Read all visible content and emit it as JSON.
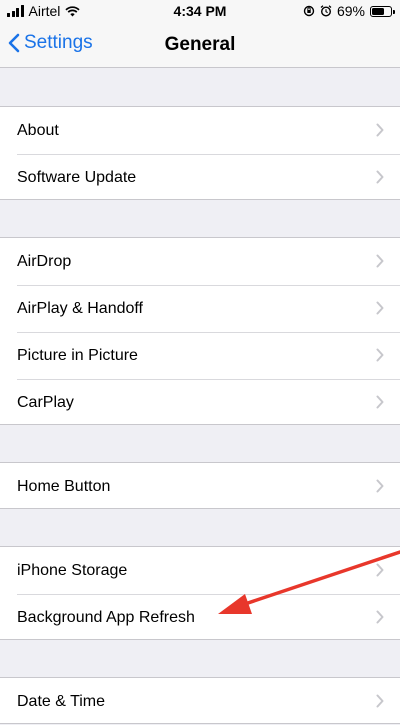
{
  "status_bar": {
    "carrier": "Airtel",
    "time": "4:34 PM",
    "battery_percent": "69%",
    "battery_level": 0.69,
    "icons": [
      "signal-icon",
      "wifi-icon",
      "screen-lock-icon",
      "alarm-icon",
      "battery-icon"
    ]
  },
  "nav": {
    "back_label": "Settings",
    "title": "General"
  },
  "groups": [
    {
      "items": [
        {
          "label": "About"
        },
        {
          "label": "Software Update"
        }
      ]
    },
    {
      "items": [
        {
          "label": "AirDrop"
        },
        {
          "label": "AirPlay & Handoff"
        },
        {
          "label": "Picture in Picture"
        },
        {
          "label": "CarPlay"
        }
      ]
    },
    {
      "items": [
        {
          "label": "Home Button"
        }
      ]
    },
    {
      "items": [
        {
          "label": "iPhone Storage"
        },
        {
          "label": "Background App Refresh"
        }
      ]
    },
    {
      "items": [
        {
          "label": "Date & Time"
        }
      ]
    }
  ],
  "colors": {
    "accent": "#1a73e8",
    "annotation_arrow": "#e8372b",
    "chevron": "#c7c7cc"
  }
}
